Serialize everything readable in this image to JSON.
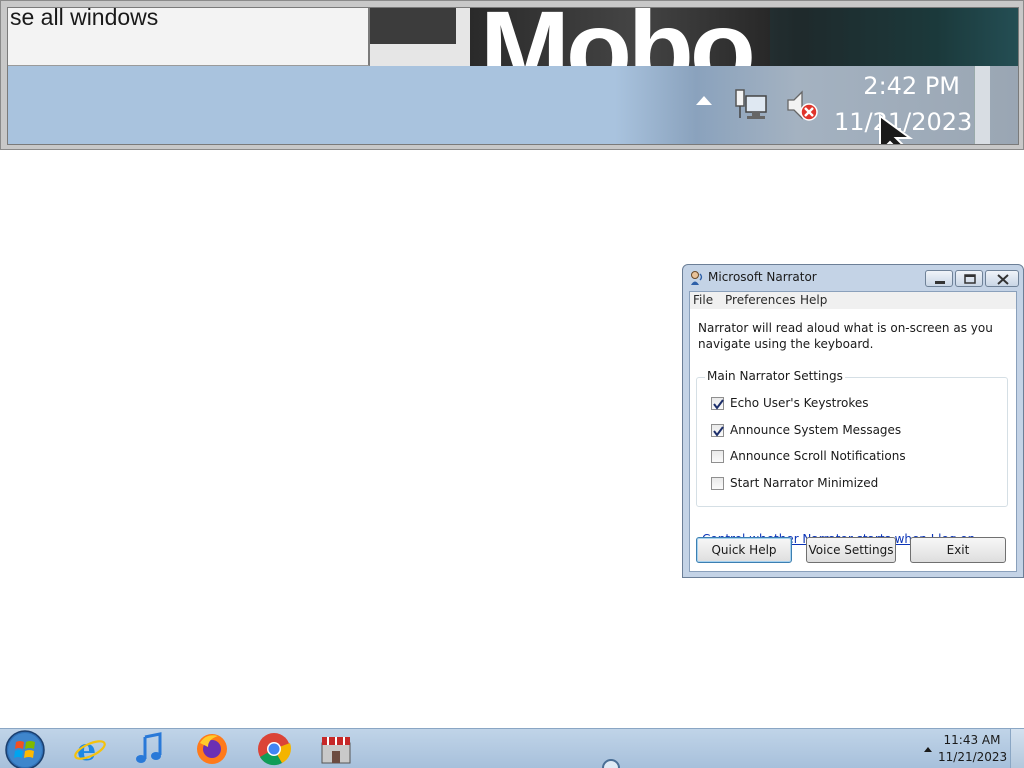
{
  "magnifier": {
    "tooltip_text": "se all windows",
    "wallpaper_text": "Mobo",
    "time": "2:42 PM",
    "date": "11/21/2023",
    "icons": [
      "tray-up-arrow-icon",
      "network-icon",
      "volume-muted-icon",
      "mouse-cursor-icon"
    ]
  },
  "narrator": {
    "title": "Microsoft Narrator",
    "menu": [
      "File",
      "Preferences",
      "Help"
    ],
    "description": "Narrator will read aloud what is on-screen as you navigate using the keyboard.",
    "group_title": "Main Narrator Settings",
    "options": [
      {
        "label": "Echo User's Keystrokes",
        "checked": true
      },
      {
        "label": "Announce System Messages",
        "checked": true
      },
      {
        "label": "Announce Scroll Notifications",
        "checked": false
      },
      {
        "label": "Start Narrator Minimized",
        "checked": false
      }
    ],
    "link": "Control whether Narrator starts when I log on",
    "buttons": {
      "quick_help": "Quick Help",
      "voice_settings": "Voice Settings",
      "exit": "Exit"
    }
  },
  "taskbar": {
    "pinned": [
      "start-orb-icon",
      "internet-explorer-icon",
      "itunes-icon",
      "firefox-icon",
      "chrome-icon",
      "store-icon"
    ],
    "time": "11:43 AM",
    "date": "11/21/2023"
  },
  "colors": {
    "taskbar": "#a7c0db",
    "window_frame": "#c4d3e6",
    "link": "#0b34b8"
  }
}
